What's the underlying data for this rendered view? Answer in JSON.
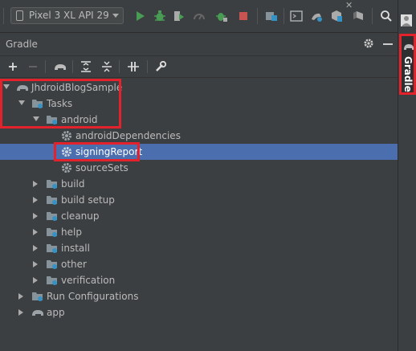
{
  "toolbar": {
    "device": "Pixel 3 XL API 29",
    "icons": [
      "run-icon",
      "debug-icon",
      "coverage-icon",
      "profiler-icon",
      "attach-debugger-icon",
      "stop-icon",
      "project-structure-icon",
      "terminal-icon",
      "avd-manager-icon",
      "sdk-manager-icon",
      "layout-inspector-icon",
      "search-icon",
      "user-avatar-icon"
    ]
  },
  "panel": {
    "title": "Gradle",
    "side_tab_label": "Gradle",
    "toolbar_icons": [
      "add-icon",
      "remove-icon",
      "gradle-elephant-icon",
      "expand-all-icon",
      "collapse-all-icon",
      "toggle-offline-icon",
      "wrench-icon"
    ]
  },
  "tree": [
    {
      "label": "JhdroidBlogSample",
      "level": 0,
      "expanded": true,
      "icon": "gradle-elephant-icon"
    },
    {
      "label": "Tasks",
      "level": 1,
      "expanded": true,
      "icon": "folder-gear-icon"
    },
    {
      "label": "android",
      "level": 2,
      "expanded": true,
      "icon": "folder-gear-icon"
    },
    {
      "label": "androidDependencies",
      "level": 3,
      "icon": "gear-icon"
    },
    {
      "label": "signingReport",
      "level": 3,
      "icon": "gear-icon",
      "selected": true
    },
    {
      "label": "sourceSets",
      "level": 3,
      "icon": "gear-icon"
    },
    {
      "label": "build",
      "level": 2,
      "expanded": false,
      "icon": "folder-gear-icon"
    },
    {
      "label": "build setup",
      "level": 2,
      "expanded": false,
      "icon": "folder-gear-icon"
    },
    {
      "label": "cleanup",
      "level": 2,
      "expanded": false,
      "icon": "folder-gear-icon"
    },
    {
      "label": "help",
      "level": 2,
      "expanded": false,
      "icon": "folder-gear-icon"
    },
    {
      "label": "install",
      "level": 2,
      "expanded": false,
      "icon": "folder-gear-icon"
    },
    {
      "label": "other",
      "level": 2,
      "expanded": false,
      "icon": "folder-gear-icon"
    },
    {
      "label": "verification",
      "level": 2,
      "expanded": false,
      "icon": "folder-gear-icon"
    },
    {
      "label": "Run Configurations",
      "level": 1,
      "expanded": false,
      "icon": "folder-gear-icon"
    },
    {
      "label": "app",
      "level": 1,
      "expanded": false,
      "icon": "gradle-elephant-icon"
    }
  ],
  "colors": {
    "background": "#3c3f41",
    "selection": "#4b6eaf",
    "annotation_red": "#e3222b",
    "run_green": "#499c54",
    "stop_red": "#c75450"
  }
}
